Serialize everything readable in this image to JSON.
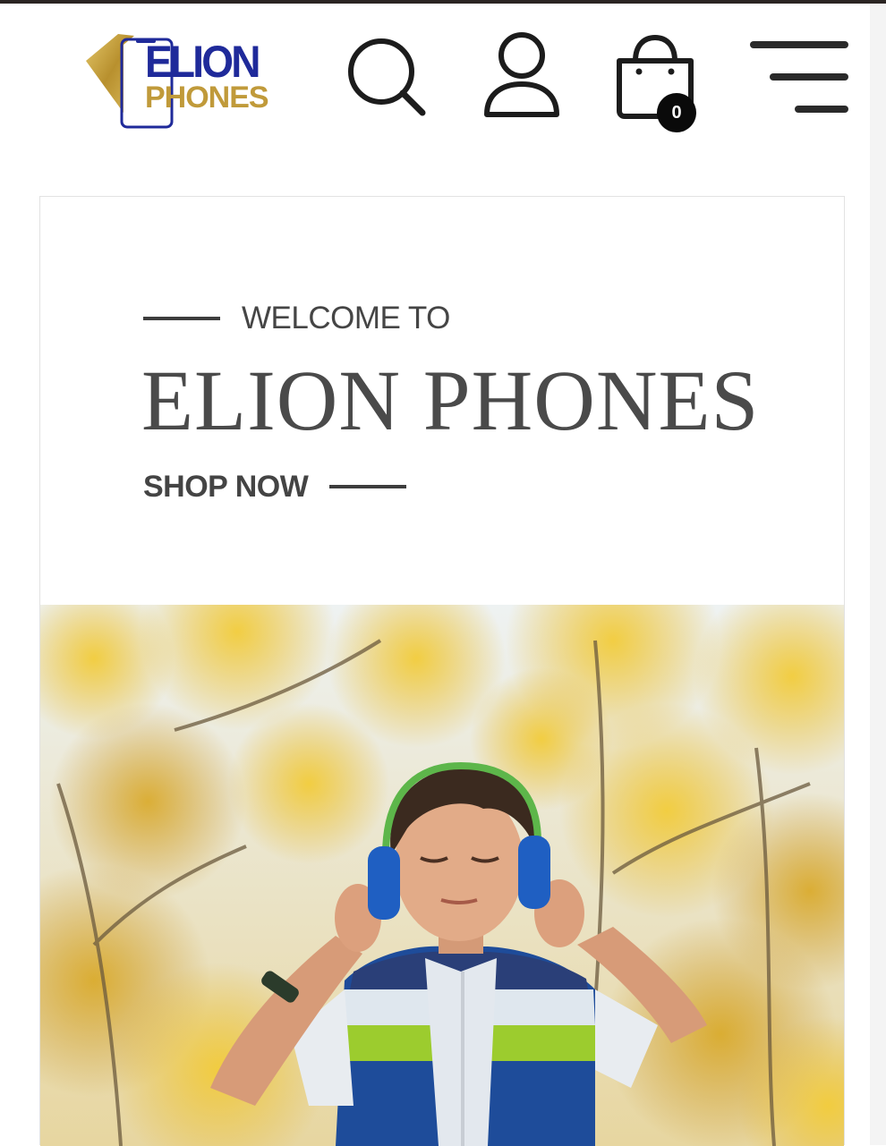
{
  "header": {
    "logo": {
      "line1": "ELION",
      "line2": "PHONES"
    },
    "icons": [
      "search-icon",
      "user-icon",
      "shopping-bag-icon",
      "menu-icon"
    ],
    "cart_count": "0"
  },
  "hero": {
    "welcome": "WELCOME TO",
    "title": "ELION PHONES",
    "cta": "SHOP NOW",
    "image": "boy-with-headphones-autumn-trees"
  },
  "colors": {
    "logo_blue": "#1f2a9a",
    "logo_gold": "#c09a3a",
    "text_gray": "#4a4a4a",
    "badge_black": "#0a0a0a"
  }
}
